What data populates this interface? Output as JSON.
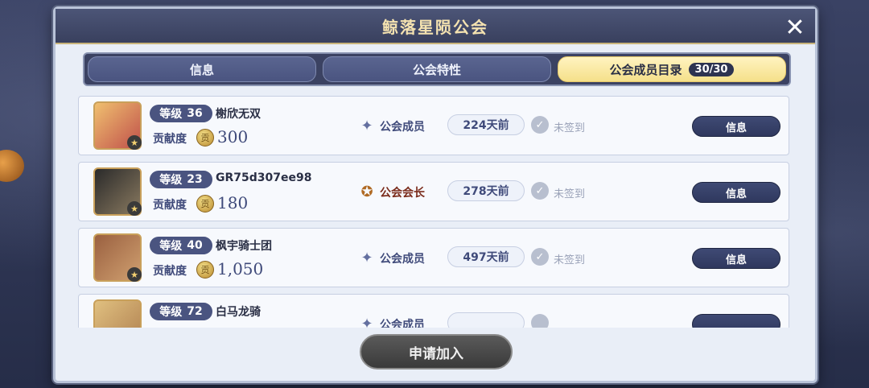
{
  "dialog": {
    "title": "鲸落星陨公会",
    "close_label": "✕"
  },
  "tabs": [
    {
      "label": "信息",
      "active": false
    },
    {
      "label": "公会特性",
      "active": false
    },
    {
      "label": "公会成员目录",
      "active": true,
      "badge": "30/30"
    }
  ],
  "labels": {
    "level": "等级",
    "contribution": "贡献度",
    "not_signed": "未签到",
    "info_button": "信息",
    "coin_glyph": "贡",
    "check_glyph": "✓",
    "star_glyph": "★"
  },
  "members": [
    {
      "level": "36",
      "name": "榭欣无双",
      "contribution": "300",
      "role": "公会成员",
      "role_type": "member",
      "days": "224天前",
      "avatar_colors": [
        "#f0c070",
        "#c0504a"
      ]
    },
    {
      "level": "23",
      "name": "GR75d307ee98",
      "contribution": "180",
      "role": "公会会长",
      "role_type": "leader",
      "days": "278天前",
      "avatar_colors": [
        "#2a2a2a",
        "#8a7a60"
      ]
    },
    {
      "level": "40",
      "name": "枫宇骑士团",
      "contribution": "1,050",
      "role": "公会成员",
      "role_type": "member",
      "days": "497天前",
      "avatar_colors": [
        "#9a6040",
        "#d0a070"
      ]
    },
    {
      "level": "72",
      "name": "白马龙骑",
      "contribution": "",
      "role": "公会成员",
      "role_type": "member",
      "days": "",
      "avatar_colors": [
        "#e0c080",
        "#b08050"
      ]
    }
  ],
  "join_button": "申请加入",
  "colors": {
    "accent_gold": "#f5e08a",
    "title_gold": "#f4e2b0",
    "navy": "#3f4a74"
  }
}
